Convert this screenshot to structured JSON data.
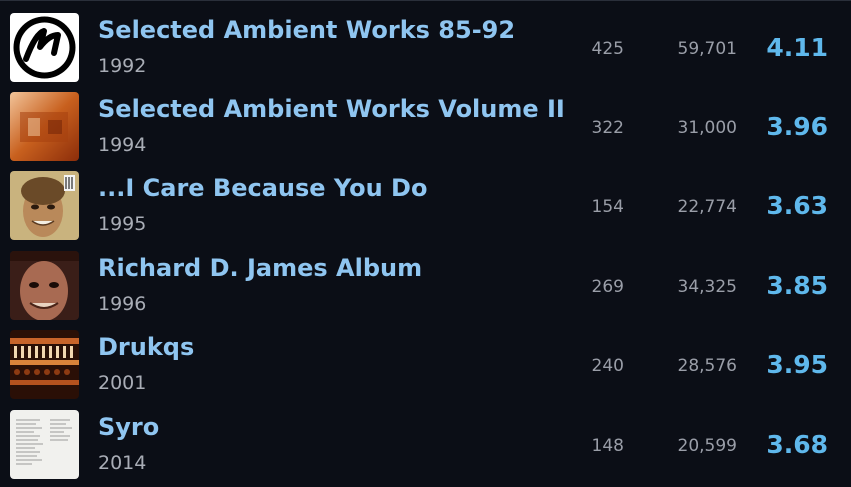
{
  "albums": [
    {
      "title": "Selected Ambient Works 85-92",
      "year": "1992",
      "ratings": "425",
      "reviews": "59,701",
      "score": "4.11",
      "cover_icon": "aphex-logo-cover"
    },
    {
      "title": "Selected Ambient Works Volume II",
      "year": "1994",
      "ratings": "322",
      "reviews": "31,000",
      "score": "3.96",
      "cover_icon": "orange-cover"
    },
    {
      "title": "...I Care Because You Do",
      "year": "1995",
      "ratings": "154",
      "reviews": "22,774",
      "score": "3.63",
      "cover_icon": "portrait-cover"
    },
    {
      "title": "Richard D. James Album",
      "year": "1996",
      "ratings": "269",
      "reviews": "34,325",
      "score": "3.85",
      "cover_icon": "face-cover"
    },
    {
      "title": "Drukqs",
      "year": "2001",
      "ratings": "240",
      "reviews": "28,576",
      "score": "3.95",
      "cover_icon": "mechanism-cover"
    },
    {
      "title": "Syro",
      "year": "2014",
      "ratings": "148",
      "reviews": "20,599",
      "score": "3.68",
      "cover_icon": "text-list-cover"
    }
  ],
  "colors": {
    "background": "#0b0e16",
    "title": "#8fc5f0",
    "score": "#5fb8ec",
    "secondary": "#9a9ea8"
  }
}
